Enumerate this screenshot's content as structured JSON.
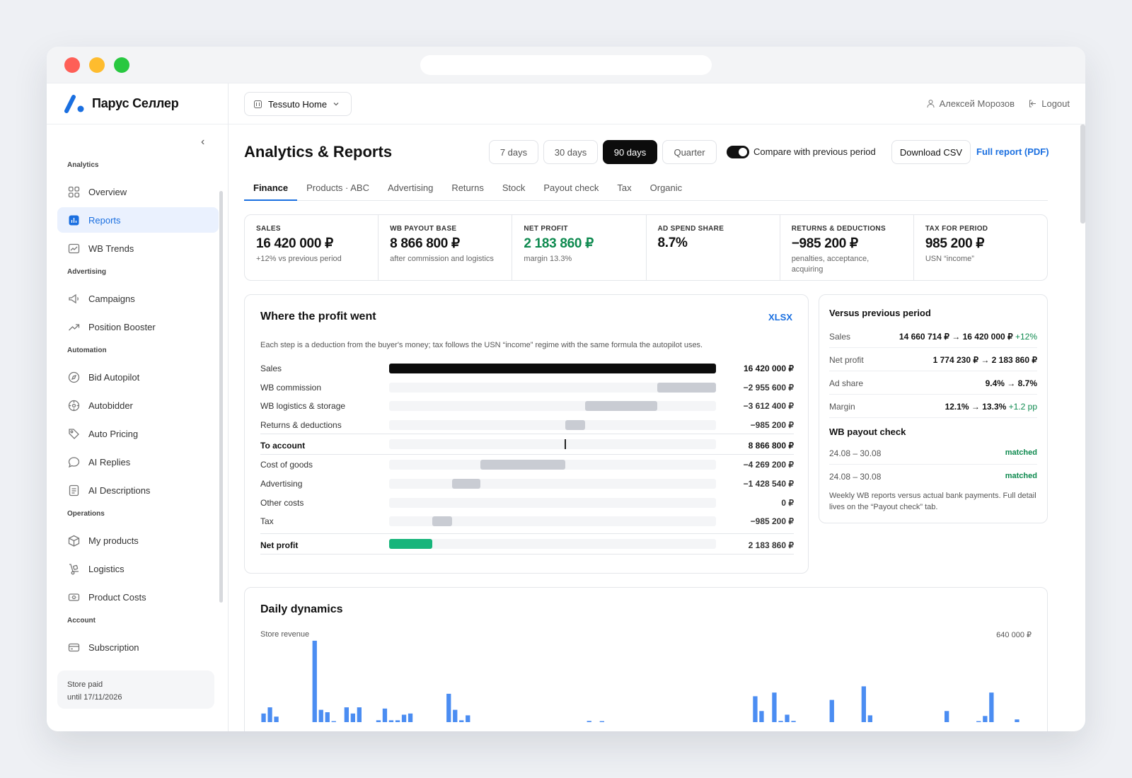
{
  "brand": {
    "name": "Парус Селлер",
    "accent": "#1a6fe0"
  },
  "sidebar": {
    "sections": [
      {
        "title": "Analytics",
        "items": [
          {
            "label": "Overview",
            "icon": "grid-icon"
          },
          {
            "label": "Reports",
            "icon": "bar-chart-icon",
            "active": true
          },
          {
            "label": "WB Trends",
            "icon": "trend-card-icon"
          }
        ]
      },
      {
        "title": "Advertising",
        "items": [
          {
            "label": "Campaigns",
            "icon": "megaphone-icon"
          },
          {
            "label": "Position Booster",
            "icon": "trending-up-icon"
          }
        ]
      },
      {
        "title": "Automation",
        "items": [
          {
            "label": "Bid Autopilot",
            "icon": "compass-icon"
          },
          {
            "label": "Autobidder",
            "icon": "target-icon"
          },
          {
            "label": "Auto Pricing",
            "icon": "tag-icon"
          },
          {
            "label": "AI Replies",
            "icon": "chat-icon"
          },
          {
            "label": "AI Descriptions",
            "icon": "document-icon"
          }
        ]
      },
      {
        "title": "Operations",
        "items": [
          {
            "label": "My products",
            "icon": "box-icon"
          },
          {
            "label": "Logistics",
            "icon": "hand-truck-icon"
          },
          {
            "label": "Product Costs",
            "icon": "cash-icon"
          }
        ]
      },
      {
        "title": "Account",
        "items": [
          {
            "label": "Subscription",
            "icon": "credit-card-icon"
          }
        ]
      }
    ],
    "paid_line1": "Store paid",
    "paid_line2": "until 17/11/2026"
  },
  "topbar": {
    "store": "Tessuto Home",
    "user": "Алексей Морозов",
    "logout": "Logout"
  },
  "page": {
    "title": "Analytics & Reports",
    "periods": [
      "7 days",
      "30 days",
      "90 days",
      "Quarter"
    ],
    "active_period": "90 days",
    "compare_label": "Compare with previous period",
    "compare_on": true,
    "download_csv": "Download CSV",
    "full_report": "Full report (PDF)",
    "tabs": [
      "Finance",
      "Products · ABC",
      "Advertising",
      "Returns",
      "Stock",
      "Payout check",
      "Tax",
      "Organic"
    ],
    "active_tab": "Finance"
  },
  "kpis": [
    {
      "label": "SALES",
      "value": "16 420 000 ₽",
      "sub": "+12% vs previous period"
    },
    {
      "label": "WB PAYOUT BASE",
      "value": "8 866 800 ₽",
      "sub": "after commission and logistics"
    },
    {
      "label": "NET PROFIT",
      "value": "2 183 860 ₽",
      "sub": "margin 13.3%",
      "positive": true
    },
    {
      "label": "AD SPEND SHARE",
      "value": "8.7%",
      "sub": ""
    },
    {
      "label": "RETURNS & DEDUCTIONS",
      "value": "−985 200 ₽",
      "sub": "penalties, acceptance, acquiring"
    },
    {
      "label": "TAX FOR PERIOD",
      "value": "985 200 ₽",
      "sub": "USN “income”"
    }
  ],
  "waterfall": {
    "title": "Where the profit went",
    "export": "XLSX",
    "description": "Each step is a deduction from the buyer's money; tax follows the USN “income” regime with the same formula the autopilot uses.",
    "total": 16420000,
    "rows": [
      {
        "label": "Sales",
        "amount": 16420000,
        "value": "16 420 000 ₽",
        "kind": "total"
      },
      {
        "label": "WB commission",
        "amount": -2955600,
        "value": "−2 955 600 ₽",
        "kind": "step"
      },
      {
        "label": "WB logistics & storage",
        "amount": -3612400,
        "value": "−3 612 400 ₽",
        "kind": "step"
      },
      {
        "label": "Returns & deductions",
        "amount": -985200,
        "value": "−985 200 ₽",
        "kind": "step"
      },
      {
        "label": "To account",
        "amount": 8866800,
        "value": "8 866 800 ₽",
        "kind": "subtotal"
      },
      {
        "label": "Cost of goods",
        "amount": -4269200,
        "value": "−4 269 200 ₽",
        "kind": "step"
      },
      {
        "label": "Advertising",
        "amount": -1428540,
        "value": "−1 428 540 ₽",
        "kind": "step"
      },
      {
        "label": "Other costs",
        "amount": 0,
        "value": "0 ₽",
        "kind": "step"
      },
      {
        "label": "Tax",
        "amount": -985200,
        "value": "−985 200 ₽",
        "kind": "step"
      },
      {
        "label": "Net profit",
        "amount": 2183860,
        "value": "2 183 860 ₽",
        "kind": "net"
      }
    ]
  },
  "versus": {
    "title": "Versus previous period",
    "rows": [
      {
        "label": "Sales",
        "value": "14 660 714 ₽ → 16 420 000 ₽",
        "delta": "+12%"
      },
      {
        "label": "Net profit",
        "value": "1 774 230 ₽ → 2 183 860 ₽",
        "delta": ""
      },
      {
        "label": "Ad share",
        "value": "9.4% → 8.7%",
        "delta": ""
      },
      {
        "label": "Margin",
        "value": "12.1% → 13.3%",
        "delta": "+1.2 pp"
      }
    ],
    "payout_title": "WB payout check",
    "payouts": [
      {
        "period": "24.08 – 30.08",
        "status": "matched"
      },
      {
        "period": "24.08 – 30.08",
        "status": "matched"
      }
    ],
    "note": "Weekly WB reports versus actual bank payments. Full detail lives on the “Payout check” tab."
  },
  "daily": {
    "title": "Daily dynamics",
    "series_label": "Store revenue",
    "max_label": "640 000 ₽"
  },
  "chart_data": {
    "type": "bar",
    "title": "Daily dynamics",
    "ylabel": "Store revenue",
    "ylim": [
      0,
      640000
    ],
    "series": [
      {
        "name": "Store revenue",
        "color": "#4b8df2",
        "values": [
          70000,
          120000,
          45000,
          0,
          0,
          0,
          0,
          0,
          660000,
          100000,
          80000,
          8000,
          0,
          120000,
          70000,
          120000,
          0,
          0,
          15000,
          110000,
          15000,
          15000,
          60000,
          70000,
          0,
          0,
          0,
          0,
          0,
          230000,
          100000,
          15000,
          55000,
          0,
          0,
          0,
          0,
          0,
          0,
          0,
          0,
          0,
          0,
          0,
          0,
          0,
          0,
          0,
          0,
          0,
          0,
          10000,
          0,
          8000,
          0,
          0,
          0,
          0,
          0,
          0,
          0,
          0,
          0,
          0,
          0,
          0,
          0,
          0,
          0,
          0,
          0,
          0,
          0,
          0,
          0,
          0,
          0,
          210000,
          90000,
          0,
          240000,
          10000,
          60000,
          10000,
          0,
          0,
          0,
          0,
          0,
          180000,
          0,
          0,
          0,
          0,
          290000,
          55000,
          0,
          0,
          0,
          0,
          0,
          0,
          0,
          0,
          0,
          0,
          0,
          90000,
          0,
          0,
          0,
          0,
          8000,
          50000,
          240000,
          0,
          0,
          0,
          22000,
          0,
          0
        ]
      }
    ]
  }
}
